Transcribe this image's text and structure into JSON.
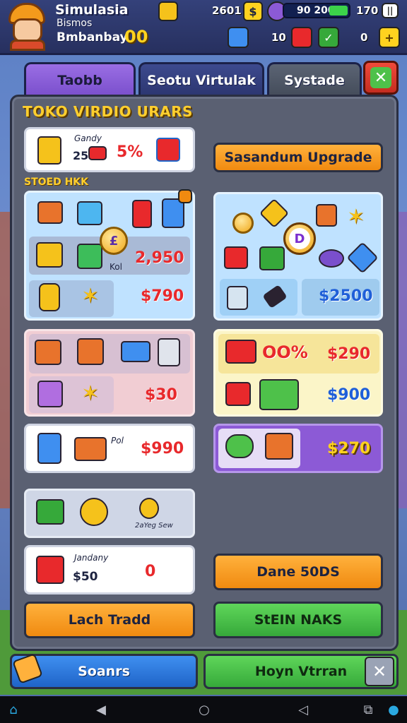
{
  "hud": {
    "title": "Simulasia",
    "line2": "Bismos",
    "line3": "Bmbanbay",
    "line3_value": "00",
    "value_a": "2601",
    "energy": "90 200",
    "energy_level": 0.3,
    "value_b": "170",
    "row2_a": "10",
    "row2_b": "0"
  },
  "tabs": [
    {
      "label": "Taobb"
    },
    {
      "label": "Seotu Virtulak"
    },
    {
      "label": "Systade"
    }
  ],
  "panel": {
    "title": "TOKO VIRDIO URARS",
    "section_label": "STOED HKK",
    "upgrade_button": "Sasandum Upgrade",
    "top_card": {
      "note": "Gandy",
      "num": "25",
      "percent": "5%"
    },
    "card_a": {
      "price_mid": "2,950",
      "note": "Kol",
      "price_low": "$790",
      "coin": "£"
    },
    "card_b": {
      "coin": "D",
      "price": "$2500"
    },
    "card_c": {
      "price": "$30"
    },
    "card_d": {
      "note": "OO%",
      "price_top": "$290",
      "price_bottom": "$900"
    },
    "card_e": {
      "note": "Pol",
      "price": "$990"
    },
    "card_f": {
      "price": "$270"
    },
    "card_g": {
      "note": "2aYeg Sew"
    },
    "card_h": {
      "note": "Jandany",
      "amount": "$50",
      "value": "0"
    },
    "btn_dane": "Dane 50DS",
    "btn_lach": "Lach Tradd",
    "btn_stein": "StEIN NAKS"
  },
  "bottom": {
    "left_button": "Soanrs",
    "right_button": "Hoyn Vtrran"
  },
  "colors": {
    "accent": "#8c5ad6",
    "price_red": "#e8292c",
    "price_blue": "#1f5fd8",
    "gold": "#ffd21f"
  }
}
